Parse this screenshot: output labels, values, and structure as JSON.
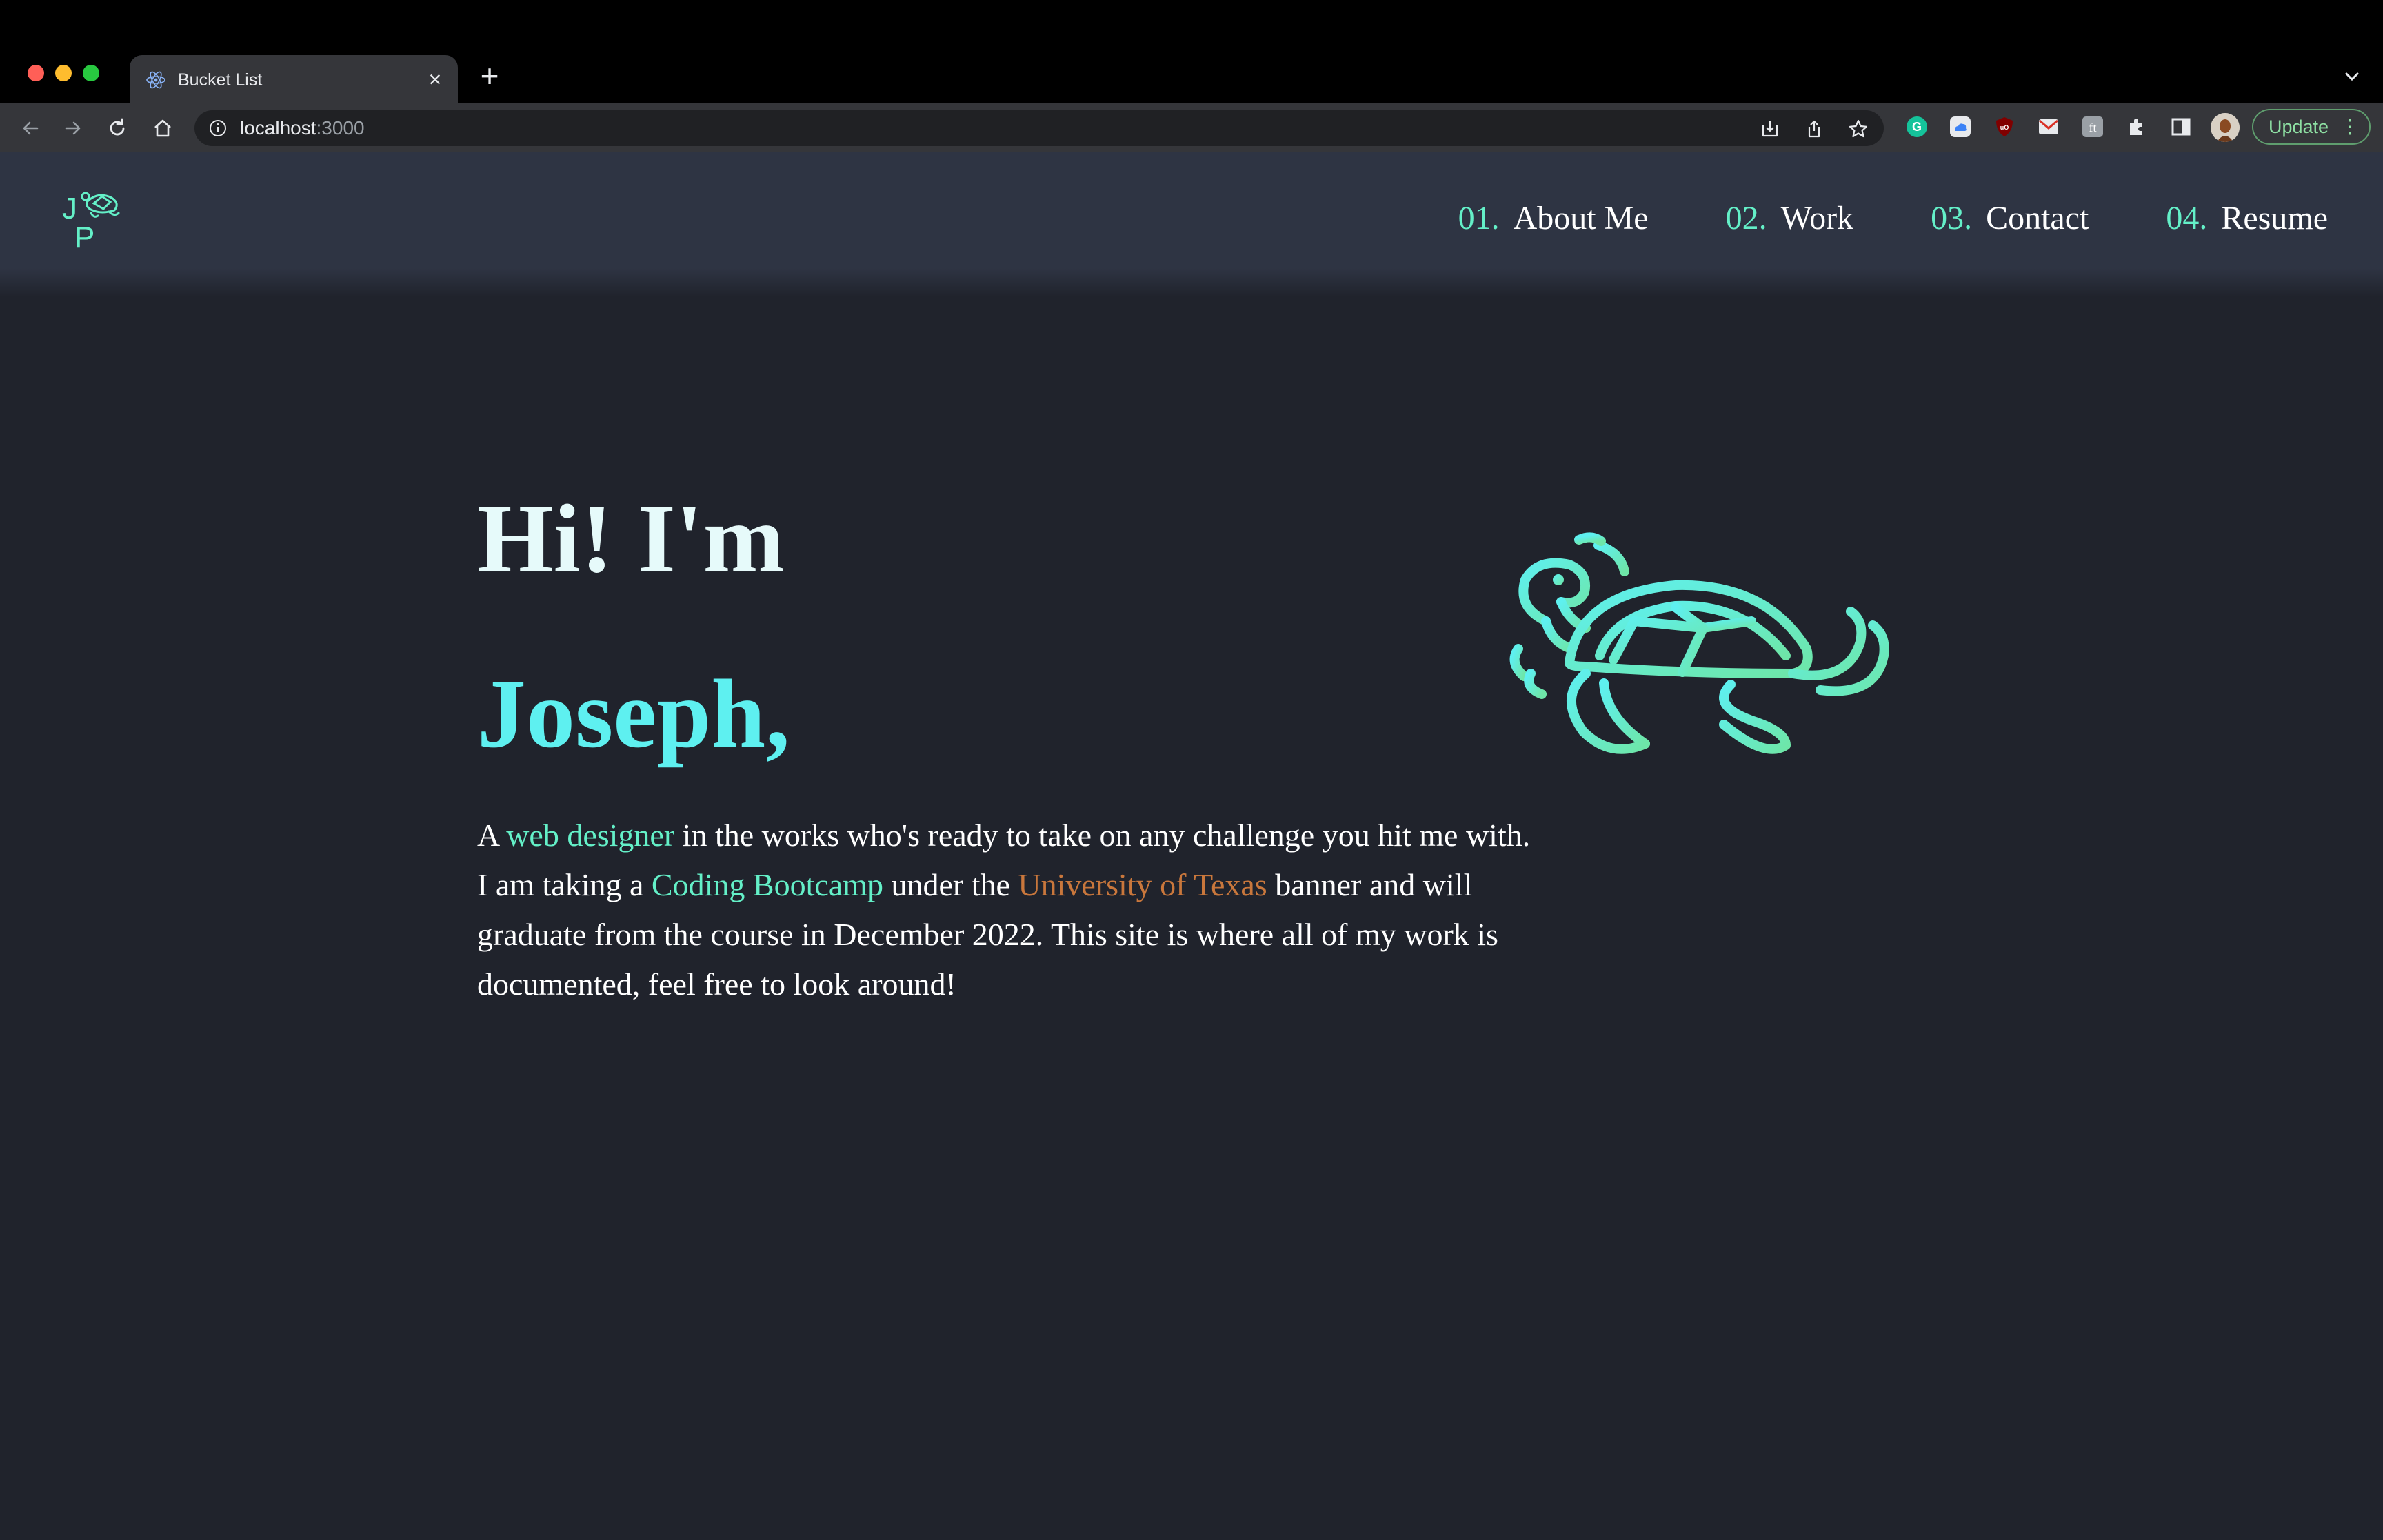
{
  "browser": {
    "tab_title": "Bucket List",
    "url_host": "localhost",
    "url_port": ":3000",
    "update_label": "Update"
  },
  "site": {
    "nav": [
      {
        "num": "01.",
        "label": "About Me"
      },
      {
        "num": "02.",
        "label": "Work"
      },
      {
        "num": "03.",
        "label": "Contact"
      },
      {
        "num": "04.",
        "label": "Resume"
      }
    ],
    "logo_letters": [
      "J",
      "P"
    ]
  },
  "hero": {
    "greeting": "Hi! I'm",
    "name": "Joseph,",
    "intro_1": "A ",
    "link_web_designer": "web designer",
    "intro_2": " in the works who's ready to take on any challenge you hit me with. I am taking a ",
    "link_bootcamp": "Coding Bootcamp",
    "intro_3": " under the ",
    "link_university": "University of Texas",
    "intro_4": " banner and will graduate from the course in December 2022. This site is where all of my work is documented, feel free to look around!"
  },
  "colors": {
    "accent": "#64f0c8",
    "name": "#5ef0f0",
    "orange_link": "#c9773c",
    "header_bg": "#2e3443",
    "page_bg": "#20232c"
  }
}
